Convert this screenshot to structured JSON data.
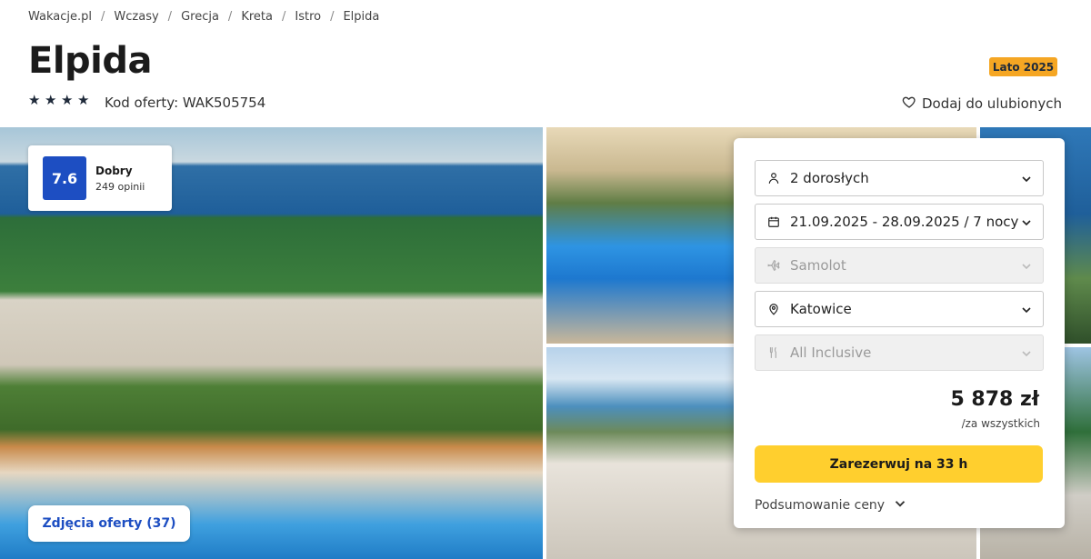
{
  "breadcrumb": [
    "Wakacje.pl",
    "Wczasy",
    "Grecja",
    "Kreta",
    "Istro",
    "Elpida"
  ],
  "hotel": {
    "name": "Elpida",
    "stars": 4,
    "offer_code": "Kod oferty: WAK505754",
    "season_badge": "Lato 2025"
  },
  "favorite_label": "Dodaj do ulubionych",
  "rating": {
    "score": "7.6",
    "label": "Dobry",
    "reviews": "249 opinii"
  },
  "photos_button": "Zdjęcia oferty (37)",
  "booking": {
    "travelers": "2 dorosłych",
    "dates": "21.09.2025 - 28.09.2025 / 7 nocy",
    "transport": "Samolot",
    "departure": "Katowice",
    "board": "All Inclusive",
    "price": "5 878 zł",
    "price_note": "/za wszystkich",
    "book_label": "Zarezerwuj na 33 h",
    "summary_label": "Podsumowanie ceny"
  },
  "colors": {
    "accent_blue": "#1d4ec2",
    "cta_yellow": "#ffcf2e",
    "badge_orange": "#f5a623"
  }
}
